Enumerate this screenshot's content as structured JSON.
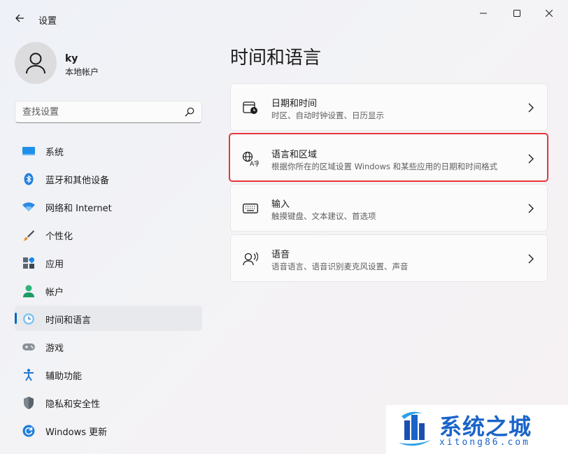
{
  "window": {
    "title": "设置"
  },
  "profile": {
    "name": "ky",
    "account_type": "本地帐户"
  },
  "search": {
    "placeholder": "查找设置"
  },
  "sidebar": {
    "items": [
      {
        "label": "系统",
        "icon": "system-icon"
      },
      {
        "label": "蓝牙和其他设备",
        "icon": "bluetooth-icon"
      },
      {
        "label": "网络和 Internet",
        "icon": "wifi-icon"
      },
      {
        "label": "个性化",
        "icon": "brush-icon"
      },
      {
        "label": "应用",
        "icon": "apps-icon"
      },
      {
        "label": "帐户",
        "icon": "account-icon"
      },
      {
        "label": "时间和语言",
        "icon": "time-language-icon",
        "active": true
      },
      {
        "label": "游戏",
        "icon": "gamepad-icon"
      },
      {
        "label": "辅助功能",
        "icon": "accessibility-icon"
      },
      {
        "label": "隐私和安全性",
        "icon": "shield-icon"
      },
      {
        "label": "Windows 更新",
        "icon": "update-icon"
      }
    ]
  },
  "main": {
    "title": "时间和语言",
    "cards": [
      {
        "title": "日期和时间",
        "desc": "时区、自动时钟设置、日历显示",
        "icon": "calendar-clock-icon"
      },
      {
        "title": "语言和区域",
        "desc": "根据你所在的区域设置 Windows 和某些应用的日期和时间格式",
        "icon": "language-region-icon",
        "highlighted": true
      },
      {
        "title": "输入",
        "desc": "触摸键盘、文本建议、首选项",
        "icon": "keyboard-icon"
      },
      {
        "title": "语音",
        "desc": "语音语言、语音识别麦克风设置、声音",
        "icon": "speech-icon"
      }
    ]
  },
  "watermark": {
    "brand": "系统之城",
    "url": "xitong86.com"
  },
  "colors": {
    "accent": "#0067c0",
    "highlight_border": "#e8353c",
    "watermark": "#1a64c9"
  }
}
